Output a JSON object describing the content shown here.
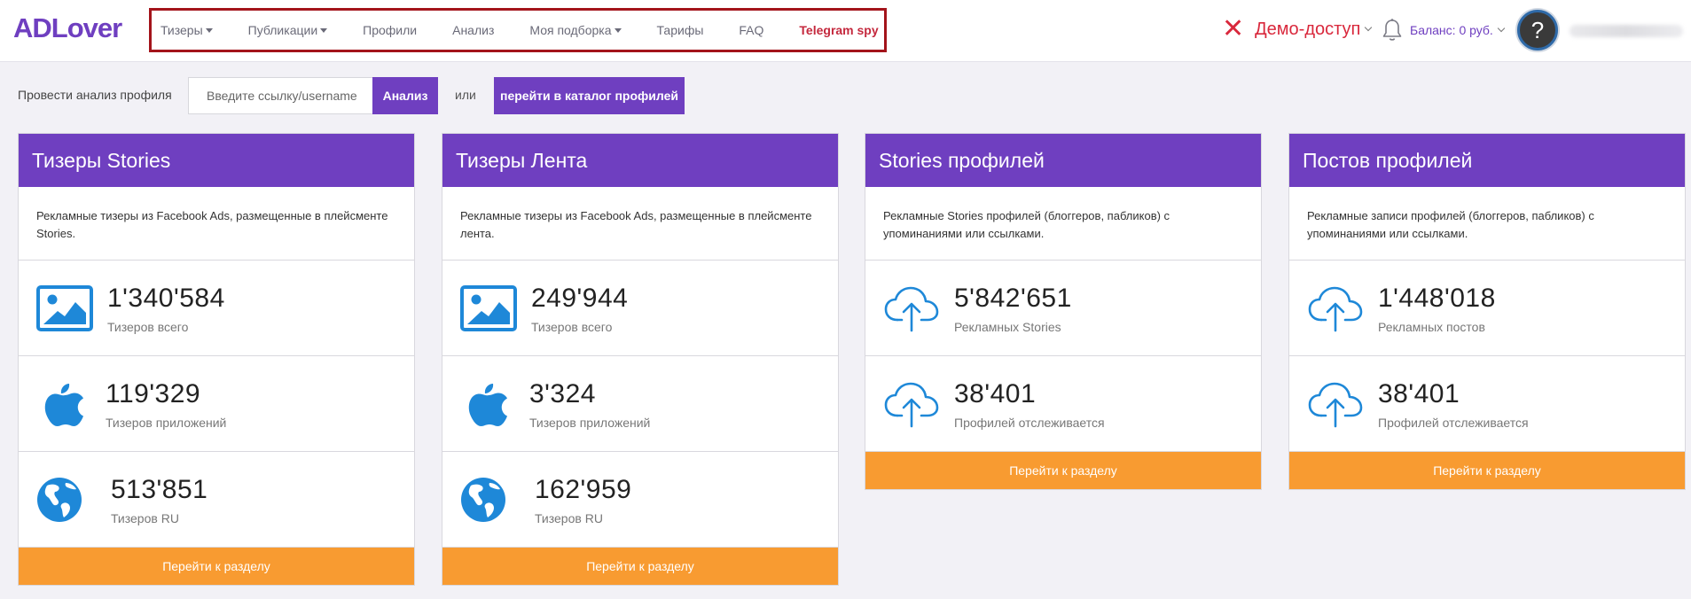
{
  "header": {
    "logo": "ADLover",
    "nav": [
      {
        "label": "Тизеры",
        "caret": true
      },
      {
        "label": "Публикации",
        "caret": true
      },
      {
        "label": "Профили",
        "caret": false
      },
      {
        "label": "Анализ",
        "caret": false
      },
      {
        "label": "Моя подборка",
        "caret": true
      },
      {
        "label": "Тарифы",
        "caret": false
      },
      {
        "label": "FAQ",
        "caret": false
      },
      {
        "label": "Telegram spy",
        "caret": false
      }
    ],
    "demo_icon": "✕",
    "demo_label": "Демо-доступ",
    "balance_label": "Баланс: 0 руб.",
    "avatar_symbol": "?"
  },
  "analyze": {
    "label": "Провести анализ профиля",
    "placeholder": "Введите ссылку/username",
    "button": "Анализ",
    "or": "или",
    "catalog_button": "перейти в каталог профилей"
  },
  "cards": [
    {
      "title": "Тизеры Stories",
      "description": "Рекламные тизеры из Facebook Ads, размещенные в плейсменте Stories.",
      "stats": [
        {
          "icon": "image-icon",
          "value": "1'340'584",
          "label": "Тизеров всего"
        },
        {
          "icon": "apple-icon",
          "value": "119'329",
          "label": "Тизеров приложений"
        },
        {
          "icon": "globe-icon",
          "value": "513'851",
          "label": "Тизеров RU"
        }
      ],
      "button": "Перейти к разделу"
    },
    {
      "title": "Тизеры Лента",
      "description": "Рекламные тизеры из Facebook Ads, размещенные в плейсменте лента.",
      "stats": [
        {
          "icon": "image-icon",
          "value": "249'944",
          "label": "Тизеров всего"
        },
        {
          "icon": "apple-icon",
          "value": "3'324",
          "label": "Тизеров приложений"
        },
        {
          "icon": "globe-icon",
          "value": "162'959",
          "label": "Тизеров RU"
        }
      ],
      "button": "Перейти к разделу"
    },
    {
      "title": "Stories профилей",
      "description": "Рекламные Stories профилей (блоггеров, пабликов) с упоминаниями или ссылками.",
      "stats": [
        {
          "icon": "cloud-upload-icon",
          "value": "5'842'651",
          "label": "Рекламных Stories"
        },
        {
          "icon": "cloud-upload-icon",
          "value": "38'401",
          "label": "Профилей отслеживается"
        }
      ],
      "button": "Перейти к разделу"
    },
    {
      "title": "Постов профилей",
      "description": "Рекламные записи профилей (блоггеров, пабликов) с упоминаниями или ссылками.",
      "stats": [
        {
          "icon": "cloud-upload-icon",
          "value": "1'448'018",
          "label": "Рекламных постов"
        },
        {
          "icon": "cloud-upload-icon",
          "value": "38'401",
          "label": "Профилей отслеживается"
        }
      ],
      "button": "Перейти к разделу"
    }
  ],
  "colors": {
    "brand_purple": "#6f3fc0",
    "accent_orange": "#f89b31",
    "icon_blue": "#1e88d8",
    "demo_red": "#d9283c",
    "highlight_border": "#a3141b"
  }
}
